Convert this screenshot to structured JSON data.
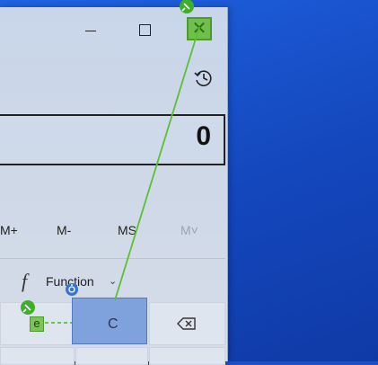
{
  "window": {
    "title_bar": {
      "minimize_icon": "minimize-icon",
      "maximize_icon": "maximize-icon",
      "close_icon": "close-icon"
    },
    "history_icon": "history-icon"
  },
  "display": {
    "value": "0"
  },
  "memory": {
    "m_plus": "M+",
    "m_minus": "M-",
    "m_store": "MS",
    "m_recall": "M˅"
  },
  "functions": {
    "glyph": "f",
    "label": "Function",
    "chevron": "⌄"
  },
  "keys": {
    "e": "e",
    "clear": "C",
    "backspace_icon": "backspace-icon"
  },
  "colors": {
    "desktop": "#1f62e0",
    "window_bg": "#cdd7e6",
    "highlight_green": "#6fbf4c",
    "highlight_blue": "#7fa2dd"
  }
}
